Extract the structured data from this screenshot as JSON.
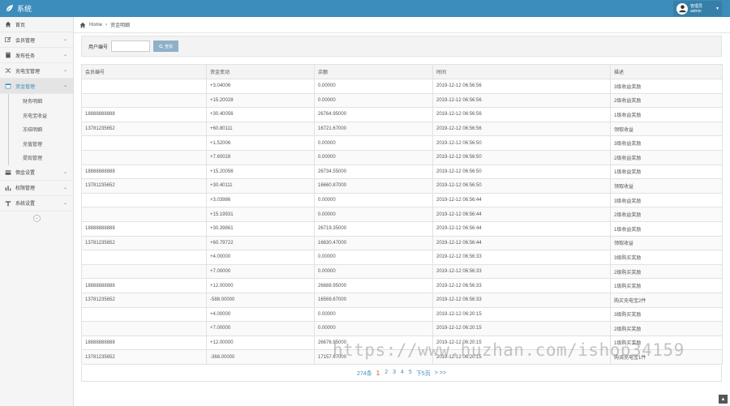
{
  "topbar": {
    "brand": "系统",
    "user_role": "管理员",
    "username": "admin"
  },
  "sidebar": {
    "items": [
      {
        "label": "首页",
        "icon": "home-icon",
        "chev": false
      },
      {
        "label": "会员管理",
        "icon": "edit-icon",
        "chev": true
      },
      {
        "label": "发布任务",
        "icon": "book-icon",
        "chev": true
      },
      {
        "label": "充电宝管理",
        "icon": "shuffle-icon",
        "chev": true
      },
      {
        "label": "资金管理",
        "icon": "calendar-icon",
        "chev": true,
        "active": true
      }
    ],
    "sub_items": [
      "财务明细",
      "充电宝收益",
      "冻结明细",
      "充值管理",
      "提现管理"
    ],
    "items_after": [
      {
        "label": "佣金设置",
        "icon": "card-icon",
        "chev": true
      },
      {
        "label": "权限管理",
        "icon": "bar-icon",
        "chev": true
      },
      {
        "label": "系统设置",
        "icon": "text-icon",
        "chev": true
      }
    ],
    "collapse_glyph": "«"
  },
  "breadcrumb": {
    "home": "Home",
    "sep": "›",
    "current": "资金明细"
  },
  "search": {
    "label": "用户编号",
    "placeholder": "",
    "button": "查找"
  },
  "table": {
    "headers": [
      "会员编号",
      "资金变动",
      "余额",
      "时间",
      "描述"
    ],
    "rows": [
      [
        "",
        "+3.04006",
        "0.00000",
        "2019-12-12 06:56:56",
        "3级收益奖励"
      ],
      [
        "",
        "+15.20028",
        "0.00000",
        "2019-12-12 06:56:56",
        "2级收益奖励"
      ],
      [
        "18888888888",
        "+30.40056",
        "26764.95000",
        "2019-12-12 06:56:56",
        "1级收益奖励"
      ],
      [
        "13781235652",
        "+60.80111",
        "16721.67000",
        "2019-12-12 06:56:56",
        "领取收益"
      ],
      [
        "",
        "+1.52006",
        "0.00000",
        "2019-12-12 06:56:50",
        "3级收益奖励"
      ],
      [
        "",
        "+7.60028",
        "0.00000",
        "2019-12-12 06:56:50",
        "2级收益奖励"
      ],
      [
        "18888888888",
        "+15.20056",
        "26734.55000",
        "2019-12-12 06:56:50",
        "1级收益奖励"
      ],
      [
        "13781235652",
        "+30.40111",
        "16660.87000",
        "2019-12-12 06:56:50",
        "领取收益"
      ],
      [
        "",
        "+3.03986",
        "0.00000",
        "2019-12-12 06:56:44",
        "3级收益奖励"
      ],
      [
        "",
        "+15.19931",
        "0.00000",
        "2019-12-12 06:56:44",
        "2级收益奖励"
      ],
      [
        "18888888888",
        "+30.39861",
        "26719.35000",
        "2019-12-12 06:56:44",
        "1级收益奖励"
      ],
      [
        "13781235652",
        "+60.79722",
        "16630.47000",
        "2019-12-12 06:56:44",
        "领取收益"
      ],
      [
        "",
        "+4.00000",
        "0.00000",
        "2019-12-12 06:56:33",
        "3级购买奖励"
      ],
      [
        "",
        "+7.00000",
        "0.00000",
        "2019-12-12 06:56:33",
        "2级购买奖励"
      ],
      [
        "18888888888",
        "+12.00000",
        "26688.95000",
        "2019-12-12 06:56:33",
        "1级购买奖励"
      ],
      [
        "13781235652",
        "-588.00000",
        "16569.67000",
        "2019-12-12 06:56:33",
        "购买充电宝2件"
      ],
      [
        "",
        "+4.00000",
        "0.00000",
        "2019-12-12 06:20:15",
        "3级购买奖励"
      ],
      [
        "",
        "+7.00000",
        "0.00000",
        "2019-12-12 06:20:15",
        "2级购买奖励"
      ],
      [
        "18888888888",
        "+12.00000",
        "26676.95000",
        "2019-12-12 06:20:15",
        "1级购买奖励"
      ],
      [
        "13781235652",
        "-368.00000",
        "17157.67000",
        "2019-12-12 06:20:15",
        "购买充电宝1件"
      ]
    ]
  },
  "pagination": {
    "total": "274条",
    "pages": [
      "1",
      "2",
      "3",
      "4",
      "5"
    ],
    "next": "下5页",
    "jump": "> >>"
  },
  "watermark": "https://www.huzhan.com/ishop34159",
  "back_top": "▲",
  "colors": {
    "primary": "#3c8dbc",
    "current_page": "#dd4b39"
  }
}
